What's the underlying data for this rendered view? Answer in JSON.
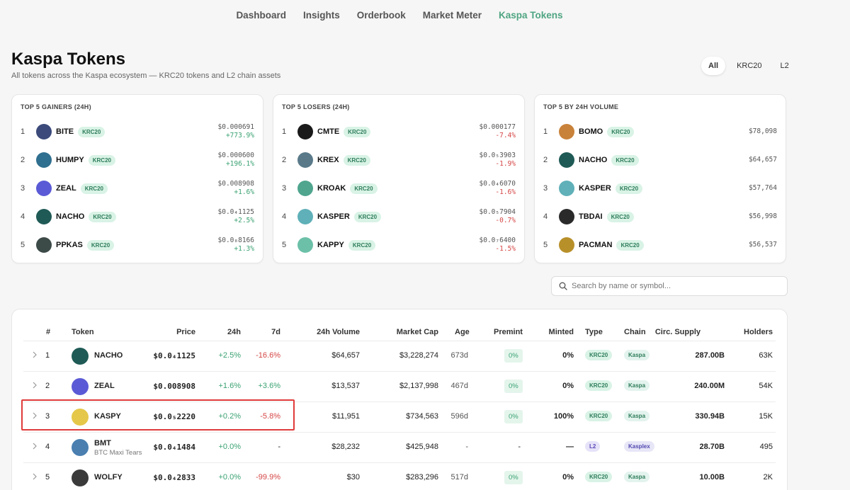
{
  "nav": {
    "items": [
      {
        "label": "Dashboard",
        "active": false
      },
      {
        "label": "Insights",
        "active": false
      },
      {
        "label": "Orderbook",
        "active": false
      },
      {
        "label": "Market Meter",
        "active": false
      },
      {
        "label": "Kaspa Tokens",
        "active": true
      }
    ],
    "active_color": "#4ea582"
  },
  "page": {
    "title": "Kaspa Tokens",
    "subtitle": "All tokens across the Kaspa ecosystem — KRC20 tokens and L2 chain assets"
  },
  "filters": [
    "All",
    "KRC20",
    "L2"
  ],
  "cards": [
    {
      "title": "TOP 5 GAINERS (24H)",
      "rows": [
        {
          "rank": "1",
          "symbol": "BITE",
          "badge": "KRC20",
          "price": "$0.000691",
          "change": "+773.9%",
          "dir": "up",
          "color": "#3b4a7a"
        },
        {
          "rank": "2",
          "symbol": "HUMPY",
          "badge": "KRC20",
          "price": "$0.000600",
          "change": "+196.1%",
          "dir": "up",
          "color": "#2f6f8f"
        },
        {
          "rank": "3",
          "symbol": "ZEAL",
          "badge": "KRC20",
          "price": "$0.008908",
          "change": "+1.6%",
          "dir": "up",
          "color": "#5a5ad6"
        },
        {
          "rank": "4",
          "symbol": "NACHO",
          "badge": "KRC20",
          "price": "$0.0₄1125",
          "change": "+2.5%",
          "dir": "up",
          "color": "#1f5a56"
        },
        {
          "rank": "5",
          "symbol": "PPKAS",
          "badge": "KRC20",
          "price": "$0.0₈8166",
          "change": "+1.3%",
          "dir": "up",
          "color": "#3c4a48"
        }
      ]
    },
    {
      "title": "TOP 5 LOSERS (24H)",
      "rows": [
        {
          "rank": "1",
          "symbol": "CMTE",
          "badge": "KRC20",
          "price": "$0.000177",
          "change": "-7.4%",
          "dir": "down",
          "color": "#1a1a1a"
        },
        {
          "rank": "2",
          "symbol": "KREX",
          "badge": "KRC20",
          "price": "$0.0₅3903",
          "change": "-1.9%",
          "dir": "down",
          "color": "#5a7a8a"
        },
        {
          "rank": "3",
          "symbol": "KROAK",
          "badge": "KRC20",
          "price": "$0.0₄6070",
          "change": "-1.6%",
          "dir": "down",
          "color": "#4fa58e"
        },
        {
          "rank": "4",
          "symbol": "KASPER",
          "badge": "KRC20",
          "price": "$0.0₅7904",
          "change": "-0.7%",
          "dir": "down",
          "color": "#5fb0b8"
        },
        {
          "rank": "5",
          "symbol": "KAPPY",
          "badge": "KRC20",
          "price": "$0.0₇6400",
          "change": "-1.5%",
          "dir": "down",
          "color": "#6cc0a8"
        }
      ]
    },
    {
      "title": "TOP 5 BY 24H VOLUME",
      "rows": [
        {
          "rank": "1",
          "symbol": "BOMO",
          "badge": "KRC20",
          "price": "$78,098",
          "change": "",
          "dir": "",
          "color": "#c9823a"
        },
        {
          "rank": "2",
          "symbol": "NACHO",
          "badge": "KRC20",
          "price": "$64,657",
          "change": "",
          "dir": "",
          "color": "#1f5a56"
        },
        {
          "rank": "3",
          "symbol": "KASPER",
          "badge": "KRC20",
          "price": "$57,764",
          "change": "",
          "dir": "",
          "color": "#5fb0b8"
        },
        {
          "rank": "4",
          "symbol": "TBDAI",
          "badge": "KRC20",
          "price": "$56,998",
          "change": "",
          "dir": "",
          "color": "#2a2a2a"
        },
        {
          "rank": "5",
          "symbol": "PACMAN",
          "badge": "KRC20",
          "price": "$56,537",
          "change": "",
          "dir": "",
          "color": "#b8902a"
        }
      ]
    }
  ],
  "search": {
    "placeholder": "Search by name or symbol..."
  },
  "table": {
    "headers": [
      "#",
      "Token",
      "Price",
      "24h",
      "7d",
      "24h Volume",
      "Market Cap",
      "Age",
      "Premint",
      "Minted",
      "Type",
      "Chain",
      "Circ. Supply",
      "Holders"
    ],
    "rows": [
      {
        "rank": "1",
        "symbol": "NACHO",
        "sub": "",
        "price": "$0.0₄1125",
        "d24": "+2.5%",
        "d24dir": "up",
        "d7": "-16.6%",
        "d7dir": "down",
        "volume": "$64,657",
        "mcap": "$3,228,274",
        "age": "673d",
        "premint": "0%",
        "minted": "0%",
        "type": "KRC20",
        "chain": "Kaspa",
        "supply": "287.00B",
        "holders": "63K",
        "color": "#1f5a56"
      },
      {
        "rank": "2",
        "symbol": "ZEAL",
        "sub": "",
        "price": "$0.008908",
        "d24": "+1.6%",
        "d24dir": "up",
        "d7": "+3.6%",
        "d7dir": "up",
        "volume": "$13,537",
        "mcap": "$2,137,998",
        "age": "467d",
        "premint": "0%",
        "minted": "0%",
        "type": "KRC20",
        "chain": "Kaspa",
        "supply": "240.00M",
        "holders": "54K",
        "color": "#5a5ad6"
      },
      {
        "rank": "3",
        "symbol": "KASPY",
        "sub": "",
        "price": "$0.0₅2220",
        "d24": "+0.2%",
        "d24dir": "up",
        "d7": "-5.8%",
        "d7dir": "down",
        "volume": "$11,951",
        "mcap": "$734,563",
        "age": "596d",
        "premint": "0%",
        "minted": "100%",
        "type": "KRC20",
        "chain": "Kaspa",
        "supply": "330.94B",
        "holders": "15K",
        "color": "#e5c84a"
      },
      {
        "rank": "4",
        "symbol": "BMT",
        "sub": "BTC Maxi Tears",
        "price": "$0.0₄1484",
        "d24": "+0.0%",
        "d24dir": "up",
        "d7": "-",
        "d7dir": "",
        "volume": "$28,232",
        "mcap": "$425,948",
        "age": "-",
        "premint": "-",
        "minted": "—",
        "type": "L2",
        "chain": "Kasplex",
        "supply": "28.70B",
        "holders": "495",
        "color": "#4a7fb0"
      },
      {
        "rank": "5",
        "symbol": "WOLFY",
        "sub": "",
        "price": "$0.0₄2833",
        "d24": "+0.0%",
        "d24dir": "up",
        "d7": "-99.9%",
        "d7dir": "down",
        "volume": "$30",
        "mcap": "$283,296",
        "age": "517d",
        "premint": "0%",
        "minted": "0%",
        "type": "KRC20",
        "chain": "Kaspa",
        "supply": "10.00B",
        "holders": "2K",
        "color": "#3a3a3a"
      }
    ]
  }
}
